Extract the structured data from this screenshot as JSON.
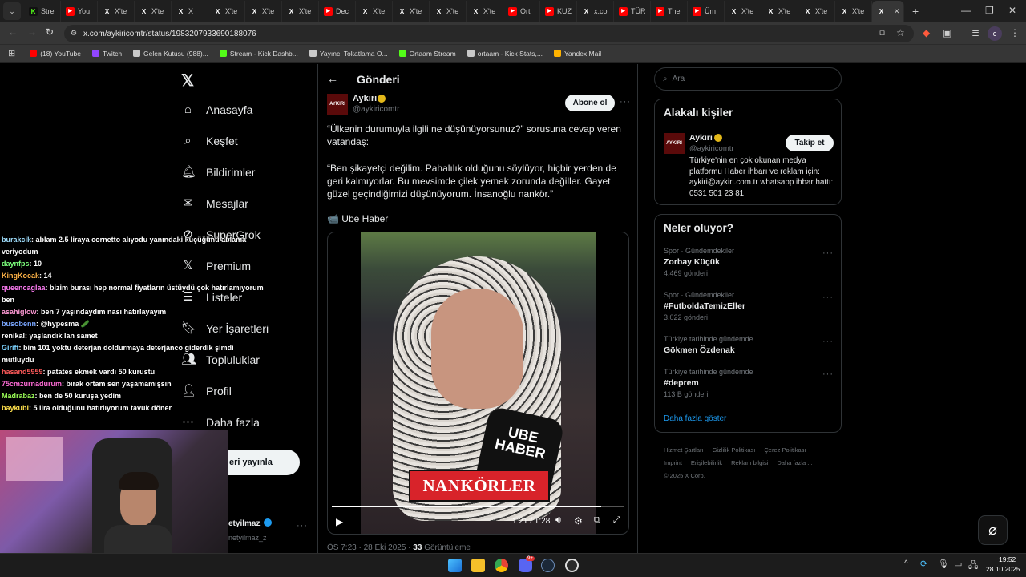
{
  "browser": {
    "tabs": [
      {
        "label": "Stre",
        "icon": "kick-icon",
        "color": "#53fc18"
      },
      {
        "label": "You",
        "icon": "youtube-icon",
        "color": "#ff0000"
      },
      {
        "label": "X'te",
        "icon": "x-icon",
        "color": "#ffffff"
      },
      {
        "label": "X'te",
        "icon": "x-icon",
        "color": "#ffffff"
      },
      {
        "label": "X",
        "icon": "x-icon",
        "color": "#ffffff"
      },
      {
        "label": "X'te",
        "icon": "x-icon",
        "color": "#ffffff"
      },
      {
        "label": "X'te",
        "icon": "x-icon",
        "color": "#ffffff"
      },
      {
        "label": "X'te",
        "icon": "x-icon",
        "color": "#ffffff"
      },
      {
        "label": "Dec",
        "icon": "youtube-icon",
        "color": "#ff0000"
      },
      {
        "label": "X'te",
        "icon": "x-icon",
        "color": "#ffffff"
      },
      {
        "label": "X'te",
        "icon": "x-icon",
        "color": "#ffffff"
      },
      {
        "label": "X'te",
        "icon": "x-icon",
        "color": "#ffffff"
      },
      {
        "label": "X'te",
        "icon": "x-icon",
        "color": "#ffffff"
      },
      {
        "label": "Ort",
        "icon": "youtube-icon",
        "color": "#ff0000"
      },
      {
        "label": "KUZ",
        "icon": "youtube-icon",
        "color": "#ff0000"
      },
      {
        "label": "x.co",
        "icon": "x-icon",
        "color": "#ffffff"
      },
      {
        "label": "TÜR",
        "icon": "youtube-icon",
        "color": "#ff0000"
      },
      {
        "label": "The",
        "icon": "youtube-icon",
        "color": "#ff0000"
      },
      {
        "label": "Üm",
        "icon": "youtube-icon",
        "color": "#ff0000"
      },
      {
        "label": "X'te",
        "icon": "x-icon",
        "color": "#ffffff"
      },
      {
        "label": "X'te",
        "icon": "x-icon",
        "color": "#ffffff"
      },
      {
        "label": "X'te",
        "icon": "x-icon",
        "color": "#ffffff"
      },
      {
        "label": "X'te",
        "icon": "x-icon",
        "color": "#ffffff"
      }
    ],
    "url": "x.com/aykiricomtr/status/1983207933690188076",
    "bookmarks": [
      {
        "label": "(18) YouTube",
        "color": "#ff0000"
      },
      {
        "label": "Twitch",
        "color": "#9146ff"
      },
      {
        "label": "Gelen Kutusu (988)...",
        "color": "#c9c9c9"
      },
      {
        "label": "Stream - Kick Dashb...",
        "color": "#53fc18"
      },
      {
        "label": "Yayıncı Tokatlama O...",
        "color": "#c9c9c9"
      },
      {
        "label": "Ortaam Stream",
        "color": "#53fc18"
      },
      {
        "label": "ortaam - Kick Stats,...",
        "color": "#c9c9c9"
      },
      {
        "label": "Yandex Mail",
        "color": "#ffb300"
      }
    ]
  },
  "nav": {
    "items": [
      {
        "label": "Anasayfa",
        "icon": "home-icon"
      },
      {
        "label": "Keşfet",
        "icon": "search-icon"
      },
      {
        "label": "Bildirimler",
        "icon": "bell-icon"
      },
      {
        "label": "Mesajlar",
        "icon": "mail-icon"
      },
      {
        "label": "SuperGrok",
        "icon": "grok-icon"
      },
      {
        "label": "Premium",
        "icon": "x-icon"
      },
      {
        "label": "Listeler",
        "icon": "list-icon"
      },
      {
        "label": "Yer İşaretleri",
        "icon": "bookmark-icon"
      },
      {
        "label": "Topluluklar",
        "icon": "people-icon"
      },
      {
        "label": "Profil",
        "icon": "person-icon"
      },
      {
        "label": "Daha fazla",
        "icon": "more-circle-icon"
      }
    ],
    "post_button": "eri yayınla",
    "account_name": "etyilmaz",
    "account_handle": "netyilmaz_z"
  },
  "chat": [
    {
      "user": "burakcik",
      "color": "#a1e0ff",
      "msg": ": ablam 2.5 liraya cornetto alıyodu yanındaki küçüğünü ablama"
    },
    {
      "user": "",
      "color": "#ffffff",
      "msg": "veriyodum"
    },
    {
      "user": "daynfps",
      "color": "#7cff7c",
      "msg": ": 10"
    },
    {
      "user": "KingKocak",
      "color": "#ffb347",
      "msg": ": 14"
    },
    {
      "user": "queencaglaa",
      "color": "#ff7cf4",
      "msg": ": bizim burası hep normal fiyatların üstüydü çok hatırlamıyorum"
    },
    {
      "user": "",
      "color": "#ffffff",
      "msg": "ben"
    },
    {
      "user": "asahiglow",
      "color": "#ff9ad5",
      "msg": ": ben 7 yaşındaydım nası hatırlayayım"
    },
    {
      "user": "busobenn",
      "color": "#7aa7ff",
      "msg": ": @hypesma 🥒"
    },
    {
      "user": "renikal",
      "color": "#ffffff",
      "msg": ": yaşlandık lan samet"
    },
    {
      "user": "Girift",
      "color": "#7cd3ff",
      "msg": ": bim 101 yoktu deterjan doldurmaya deterjanco giderdik şimdi"
    },
    {
      "user": "",
      "color": "#ffffff",
      "msg": "mutluydu"
    },
    {
      "user": "hasand5959",
      "color": "#ff5a5a",
      "msg": ": patates ekmek vardı 50 kurustu"
    },
    {
      "user": "75cmzurnadurum",
      "color": "#ff6bd6",
      "msg": ": bırak ortam sen yaşamamışsın"
    },
    {
      "user": "Madrabaz",
      "color": "#9cff57",
      "msg": ": ben de 50 kuruşa yedim"
    },
    {
      "user": "baykubi",
      "color": "#ffe14d",
      "msg": ": 5 lira olduğunu hatırlıyorum tavuk döner"
    }
  ],
  "header": {
    "title": "Gönderi"
  },
  "post": {
    "author": "Aykırı",
    "handle": "@aykiricomtr",
    "avatar_text": "AYKIRI",
    "follow_label": "Abone ol",
    "text1": "“Ülkenin durumuyla ilgili ne düşünüyorsunuz?” sorusuna cevap veren vatandaş:",
    "text2": "“Ben şikayetçi değilim. Pahalılık olduğunu söylüyor, hiçbir yerden de geri kalmıyorlar. Bu mevsimde çilek yemek zorunda değiller. Gayet güzel geçindiğimizi düşünüyorum. İnsanoğlu nankör.”",
    "source": "📹 Ube Haber",
    "video_caption": "NANKÖRLER",
    "mic_text": "UBE HABER",
    "video_time": "1:21 / 1:28",
    "video_progress": 0.92,
    "meta": "ÖS 7:23 · 28 Eki 2025 · ",
    "views": "33",
    "views_label": "Görüntüleme"
  },
  "sidebar": {
    "search_placeholder": "Ara",
    "related_title": "Alakalı kişiler",
    "related": {
      "name": "Aykırı",
      "handle": "@aykiricomtr",
      "follow": "Takip et",
      "bio": "Türkiye'nin en çok okunan medya platformu Haber ihbarı ve reklam için: aykiri@aykiri.com.tr whatsapp ihbar hattı: 0531 501 23 81"
    },
    "trends_title": "Neler oluyor?",
    "trends": [
      {
        "cat": "Spor · Gündemdekiler",
        "title": "Zorbay Küçük",
        "count": "4.469 gönderi"
      },
      {
        "cat": "Spor · Gündemdekiler",
        "title": "#FutboldaTemizEller",
        "count": "3.022 gönderi"
      },
      {
        "cat": "Türkiye tarihinde gündemde",
        "title": "Gökmen Özdenak",
        "count": ""
      },
      {
        "cat": "Türkiye tarihinde gündemde",
        "title": "#deprem",
        "count": "113 B gönderi"
      }
    ],
    "show_more": "Daha fazla göster",
    "footer1": [
      "Hizmet Şartları",
      "Gizlilik Politikası",
      "Çerez Politikası"
    ],
    "footer2": [
      "Imprint",
      "Erişilebilirlik",
      "Reklam bilgisi",
      "Daha fazla ..."
    ],
    "copyright": "© 2025 X Corp."
  },
  "taskbar": {
    "time": "19:52",
    "date": "28.10.2025",
    "badge": "9+"
  }
}
